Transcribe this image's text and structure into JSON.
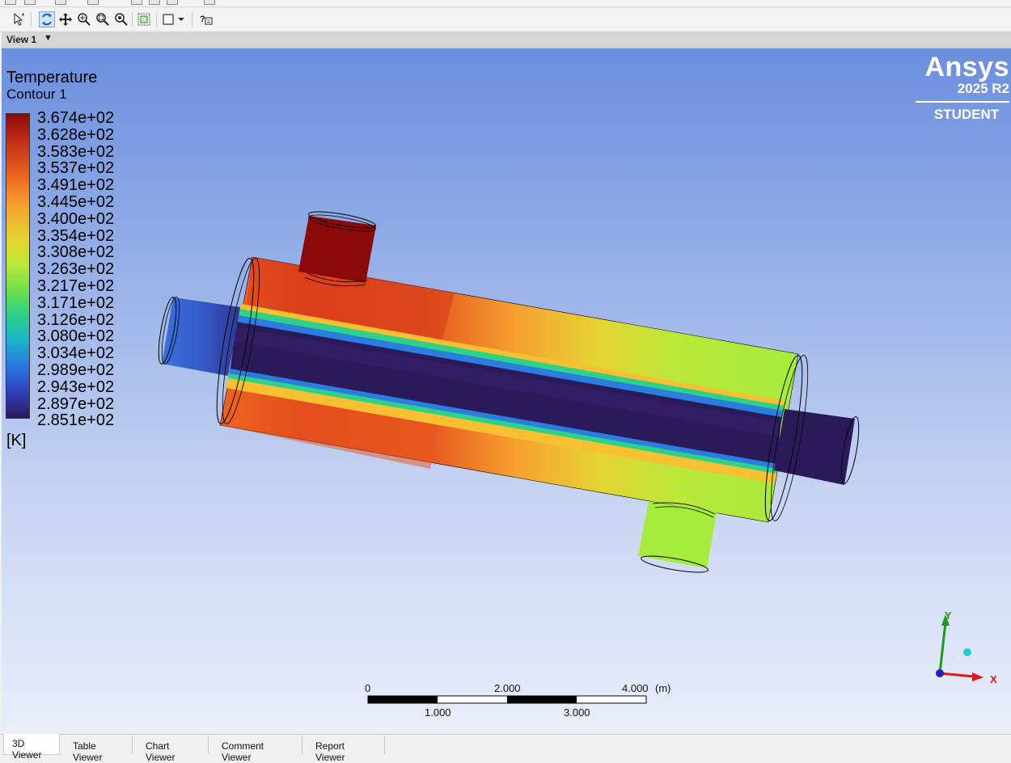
{
  "toolbar": {
    "icons": [
      "select-icon",
      "rotate-icon",
      "pan-icon",
      "zoom-icon",
      "zoom-box-icon",
      "zoom-fit-icon",
      "fit-view-icon",
      "box-zoom-icon",
      "dropdown-icon",
      "help-select-icon"
    ],
    "active": "rotate-icon"
  },
  "view": {
    "label": "View 1"
  },
  "legend": {
    "title": "Temperature",
    "subtitle": "Contour 1",
    "ticks": [
      "3.674e+02",
      "3.628e+02",
      "3.583e+02",
      "3.537e+02",
      "3.491e+02",
      "3.445e+02",
      "3.400e+02",
      "3.354e+02",
      "3.308e+02",
      "3.263e+02",
      "3.217e+02",
      "3.171e+02",
      "3.126e+02",
      "3.080e+02",
      "3.034e+02",
      "2.989e+02",
      "2.943e+02",
      "2.897e+02",
      "2.851e+02"
    ],
    "unit": "[K]"
  },
  "logo": {
    "brand": "Ansys",
    "version": "2025 R2",
    "edition": "STUDENT"
  },
  "scale": {
    "top_labels": [
      "0",
      "2.000",
      "4.000"
    ],
    "unit": "(m)",
    "bottom_labels": [
      "1.000",
      "3.000"
    ]
  },
  "axes": {
    "x": "X",
    "y": "Y"
  },
  "tabs": [
    {
      "label": "3D Viewer",
      "selected": true
    },
    {
      "label": "Table Viewer",
      "selected": false
    },
    {
      "label": "Chart Viewer",
      "selected": false
    },
    {
      "label": "Comment Viewer",
      "selected": false
    },
    {
      "label": "Report Viewer",
      "selected": false
    }
  ],
  "colors": {
    "hot": "#8a0a0a",
    "cold": "#2a1a5a",
    "accent": "#7aa7d6"
  }
}
